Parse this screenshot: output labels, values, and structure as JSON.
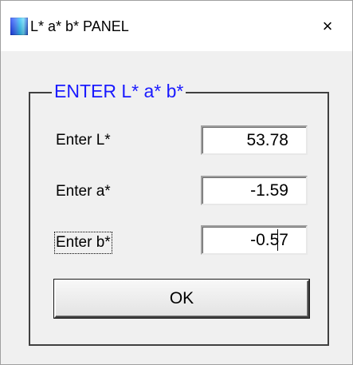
{
  "window": {
    "title": "L* a* b* PANEL",
    "close_glyph": "×",
    "icon": "app-icon"
  },
  "group": {
    "title": "ENTER L* a* b*",
    "title_color": "#1a1aff"
  },
  "fields": [
    {
      "label": "Enter L*",
      "value": "53.78"
    },
    {
      "label": "Enter a*",
      "value": "-1.59"
    },
    {
      "label": "Enter b*",
      "value": "-0.57"
    }
  ],
  "buttons": {
    "ok_label": "OK"
  }
}
